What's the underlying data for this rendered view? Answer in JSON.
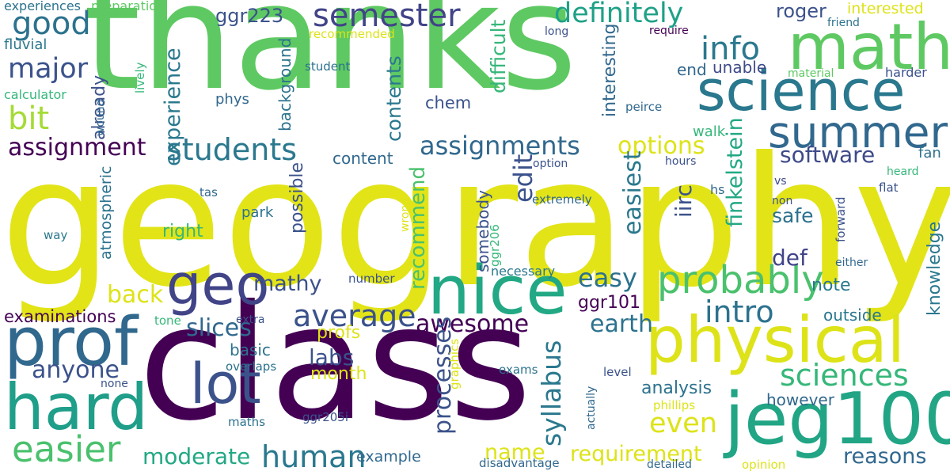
{
  "words": [
    {
      "text": "thanks",
      "color": "#5ec962",
      "vertical": false
    },
    {
      "text": "geography",
      "color": "#e2e418",
      "vertical": false
    },
    {
      "text": "class",
      "color": "#440154",
      "vertical": false
    },
    {
      "text": "science",
      "color": "#2a788e",
      "vertical": false
    },
    {
      "text": "physical",
      "color": "#dde318",
      "vertical": false
    },
    {
      "text": "math",
      "color": "#5ec962",
      "vertical": false
    },
    {
      "text": "summer",
      "color": "#31688e",
      "vertical": false
    },
    {
      "text": "jeg100",
      "color": "#21a585",
      "vertical": false
    },
    {
      "text": "nice",
      "color": "#22a884",
      "vertical": false
    },
    {
      "text": "prof",
      "color": "#31688e",
      "vertical": false
    },
    {
      "text": "hard",
      "color": "#1f9e89",
      "vertical": false
    },
    {
      "text": "lot",
      "color": "#3b528b",
      "vertical": false
    },
    {
      "text": "geo",
      "color": "#414487",
      "vertical": false
    },
    {
      "text": "probably",
      "color": "#4ac16d",
      "vertical": false
    },
    {
      "text": "semester",
      "color": "#414487",
      "vertical": false
    },
    {
      "text": "definitely",
      "color": "#1fa187",
      "vertical": false
    },
    {
      "text": "good",
      "color": "#2c728e",
      "vertical": false
    },
    {
      "text": "major",
      "color": "#3b528b",
      "vertical": false
    },
    {
      "text": "bit",
      "color": "#a5db36",
      "vertical": false
    },
    {
      "text": "info",
      "color": "#2a788e",
      "vertical": false
    },
    {
      "text": "easier",
      "color": "#4ac16d",
      "vertical": false
    },
    {
      "text": "assignment",
      "color": "#440154",
      "vertical": false
    },
    {
      "text": "students",
      "color": "#2a788e",
      "vertical": false
    },
    {
      "text": "assignments",
      "color": "#31688e",
      "vertical": false
    },
    {
      "text": "options",
      "color": "#dde318",
      "vertical": false
    },
    {
      "text": "software",
      "color": "#3e4a89",
      "vertical": false
    },
    {
      "text": "sciences",
      "color": "#35b779",
      "vertical": false
    },
    {
      "text": "average",
      "color": "#3b528b",
      "vertical": false
    },
    {
      "text": "intro",
      "color": "#2c728e",
      "vertical": false
    },
    {
      "text": "ggr223",
      "color": "#3b528b",
      "vertical": false
    },
    {
      "text": "roger",
      "color": "#3b528b",
      "vertical": false
    },
    {
      "text": "interested",
      "color": "#dde318",
      "vertical": false
    },
    {
      "text": "preparation",
      "color": "#5ec962",
      "vertical": false
    },
    {
      "text": "experiences",
      "color": "#2c728e",
      "vertical": false
    },
    {
      "text": "fluvial",
      "color": "#2a788e",
      "vertical": false
    },
    {
      "text": "calculator",
      "color": "#35b779",
      "vertical": false
    },
    {
      "text": "easy",
      "color": "#2c728e",
      "vertical": false
    },
    {
      "text": "awesome",
      "color": "#440154",
      "vertical": false
    },
    {
      "text": "earth",
      "color": "#2c728e",
      "vertical": false
    },
    {
      "text": "anyone",
      "color": "#3b528b",
      "vertical": false
    },
    {
      "text": "slices",
      "color": "#31688e",
      "vertical": false
    },
    {
      "text": "labs",
      "color": "#3b528b",
      "vertical": false
    },
    {
      "text": "mathy",
      "color": "#3b528b",
      "vertical": false
    },
    {
      "text": "back",
      "color": "#dde318",
      "vertical": false
    },
    {
      "text": "examinations",
      "color": "#440154",
      "vertical": false
    },
    {
      "text": "moderate",
      "color": "#22a884",
      "vertical": false
    },
    {
      "text": "human",
      "color": "#2a788e",
      "vertical": false
    },
    {
      "text": "even",
      "color": "#dde318",
      "vertical": false
    },
    {
      "text": "requirement",
      "color": "#dde318",
      "vertical": false
    },
    {
      "text": "reasons",
      "color": "#31688e",
      "vertical": false
    },
    {
      "text": "name",
      "color": "#dde318",
      "vertical": false
    },
    {
      "text": "example",
      "color": "#31688e",
      "vertical": false
    },
    {
      "text": "analysis",
      "color": "#2c728e",
      "vertical": false
    },
    {
      "text": "however",
      "color": "#31688e",
      "vertical": false
    },
    {
      "text": "month",
      "color": "#dde318",
      "vertical": false
    },
    {
      "text": "profs",
      "color": "#dde318",
      "vertical": false
    },
    {
      "text": "basic",
      "color": "#2c728e",
      "vertical": false
    },
    {
      "text": "ggr101",
      "color": "#440154",
      "vertical": false
    },
    {
      "text": "outside",
      "color": "#2a788e",
      "vertical": false
    },
    {
      "text": "note",
      "color": "#2a788e",
      "vertical": false
    },
    {
      "text": "safe",
      "color": "#2c728e",
      "vertical": false
    },
    {
      "text": "def",
      "color": "#414487",
      "vertical": false
    },
    {
      "text": "unable",
      "color": "#3e4a89",
      "vertical": false
    },
    {
      "text": "end",
      "color": "#31688e",
      "vertical": false
    },
    {
      "text": "chem",
      "color": "#3b528b",
      "vertical": false
    },
    {
      "text": "phys",
      "color": "#31688e",
      "vertical": false
    },
    {
      "text": "content",
      "color": "#31688e",
      "vertical": false
    },
    {
      "text": "right",
      "color": "#35b779",
      "vertical": false
    },
    {
      "text": "park",
      "color": "#2c728e",
      "vertical": false
    },
    {
      "text": "fan",
      "color": "#2c728e",
      "vertical": false
    },
    {
      "text": "vs",
      "color": "#3e4a89",
      "vertical": false
    },
    {
      "text": "hs",
      "color": "#31688e",
      "vertical": false
    },
    {
      "text": "hours",
      "color": "#3b528b",
      "vertical": false
    },
    {
      "text": "option",
      "color": "#3b528b",
      "vertical": false
    },
    {
      "text": "extremely",
      "color": "#31688e",
      "vertical": false
    },
    {
      "text": "necessary",
      "color": "#2a788e",
      "vertical": false
    },
    {
      "text": "number",
      "color": "#3b528b",
      "vertical": false
    },
    {
      "text": "walk",
      "color": "#35b779",
      "vertical": false
    },
    {
      "text": "peirce",
      "color": "#31688e",
      "vertical": false
    },
    {
      "text": "harder",
      "color": "#3b528b",
      "vertical": false
    },
    {
      "text": "material",
      "color": "#5ec962",
      "vertical": false
    },
    {
      "text": "student",
      "color": "#2c728e",
      "vertical": false
    },
    {
      "text": "recommended",
      "color": "#dde318",
      "vertical": false
    },
    {
      "text": "long",
      "color": "#3b528b",
      "vertical": false
    },
    {
      "text": "require",
      "color": "#440154",
      "vertical": false
    },
    {
      "text": "friend",
      "color": "#2c728e",
      "vertical": false
    },
    {
      "text": "heard",
      "color": "#35b779",
      "vertical": false
    },
    {
      "text": "flat",
      "color": "#3b528b",
      "vertical": false
    },
    {
      "text": "non",
      "color": "#3b528b",
      "vertical": false
    },
    {
      "text": "either",
      "color": "#31688e",
      "vertical": false
    },
    {
      "text": "tas",
      "color": "#31688e",
      "vertical": false
    },
    {
      "text": "way",
      "color": "#2a788e",
      "vertical": false
    },
    {
      "text": "tone",
      "color": "#35b779",
      "vertical": false
    },
    {
      "text": "extra",
      "color": "#3b528b",
      "vertical": false
    },
    {
      "text": "exams",
      "color": "#2c728e",
      "vertical": false
    },
    {
      "text": "level",
      "color": "#3b528b",
      "vertical": false
    },
    {
      "text": "overlaps",
      "color": "#2c728e",
      "vertical": false
    },
    {
      "text": "none",
      "color": "#3b528b",
      "vertical": false
    },
    {
      "text": "maths",
      "color": "#2c728e",
      "vertical": false
    },
    {
      "text": "ggr205i",
      "color": "#3b528b",
      "vertical": false
    },
    {
      "text": "phillips",
      "color": "#dde318",
      "vertical": false
    },
    {
      "text": "disadvantage",
      "color": "#31688e",
      "vertical": false
    },
    {
      "text": "detailed",
      "color": "#31688e",
      "vertical": false
    },
    {
      "text": "opinion",
      "color": "#dde318",
      "vertical": false
    },
    {
      "text": "contents",
      "color": "#2a788e",
      "vertical": true
    },
    {
      "text": "difficult",
      "color": "#35b779",
      "vertical": true
    },
    {
      "text": "experience",
      "color": "#2a788e",
      "vertical": true
    },
    {
      "text": "already",
      "color": "#3b528b",
      "vertical": true
    },
    {
      "text": "background",
      "color": "#2c728e",
      "vertical": true
    },
    {
      "text": "processes",
      "color": "#3b528b",
      "vertical": true
    },
    {
      "text": "syllabus",
      "color": "#2a788e",
      "vertical": true
    },
    {
      "text": "recommend",
      "color": "#4ac16d",
      "vertical": true
    },
    {
      "text": "edit",
      "color": "#3b528b",
      "vertical": true
    },
    {
      "text": "easiest",
      "color": "#2a788e",
      "vertical": true
    },
    {
      "text": "finkelstein",
      "color": "#22a884",
      "vertical": true
    },
    {
      "text": "interesting",
      "color": "#31688e",
      "vertical": true
    },
    {
      "text": "iirc",
      "color": "#3b528b",
      "vertical": true
    },
    {
      "text": "possible",
      "color": "#3b528b",
      "vertical": true
    },
    {
      "text": "atmospheric",
      "color": "#2c728e",
      "vertical": true
    },
    {
      "text": "somebody",
      "color": "#3b528b",
      "vertical": true
    },
    {
      "text": "ggr206",
      "color": "#35b779",
      "vertical": true
    },
    {
      "text": "wrong",
      "color": "#dde318",
      "vertical": true
    },
    {
      "text": "knowledge",
      "color": "#2a788e",
      "vertical": true
    },
    {
      "text": "forward",
      "color": "#3b528b",
      "vertical": true
    },
    {
      "text": "lively",
      "color": "#35b779",
      "vertical": true
    },
    {
      "text": "wound",
      "color": "#31688e",
      "vertical": true
    },
    {
      "text": "graphics",
      "color": "#dde318",
      "vertical": true
    },
    {
      "text": "actually",
      "color": "#31688e",
      "vertical": true
    }
  ]
}
